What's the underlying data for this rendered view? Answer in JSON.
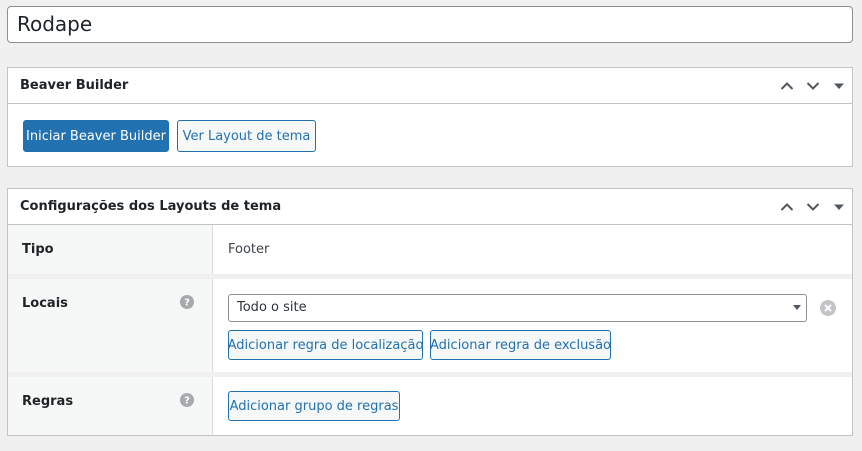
{
  "post_title": "Rodape",
  "beaver_box": {
    "title": "Beaver Builder",
    "launch_button": "Iniciar Beaver Builder",
    "view_button": "Ver Layout de tema"
  },
  "settings_box": {
    "title": "Configurações dos Layouts de tema",
    "rows": {
      "tipo": {
        "label": "Tipo",
        "value": "Footer"
      },
      "locais": {
        "label": "Locais",
        "selected_location": "Todo o site",
        "add_location_rule": "Adicionar regra de localização",
        "add_exclusion_rule": "Adicionar regra de exclusão"
      },
      "regras": {
        "label": "Regras",
        "add_rule_group": "Adicionar grupo de regras"
      }
    }
  },
  "icons": {
    "move_up": "chevron-up-icon",
    "move_down": "chevron-down-icon",
    "toggle": "triangle-down-icon",
    "help": "question-circle-icon",
    "remove": "close-circle-icon"
  },
  "colors": {
    "primary": "#2271b1",
    "background": "#f0f0f1",
    "border": "#c3c4c7"
  }
}
